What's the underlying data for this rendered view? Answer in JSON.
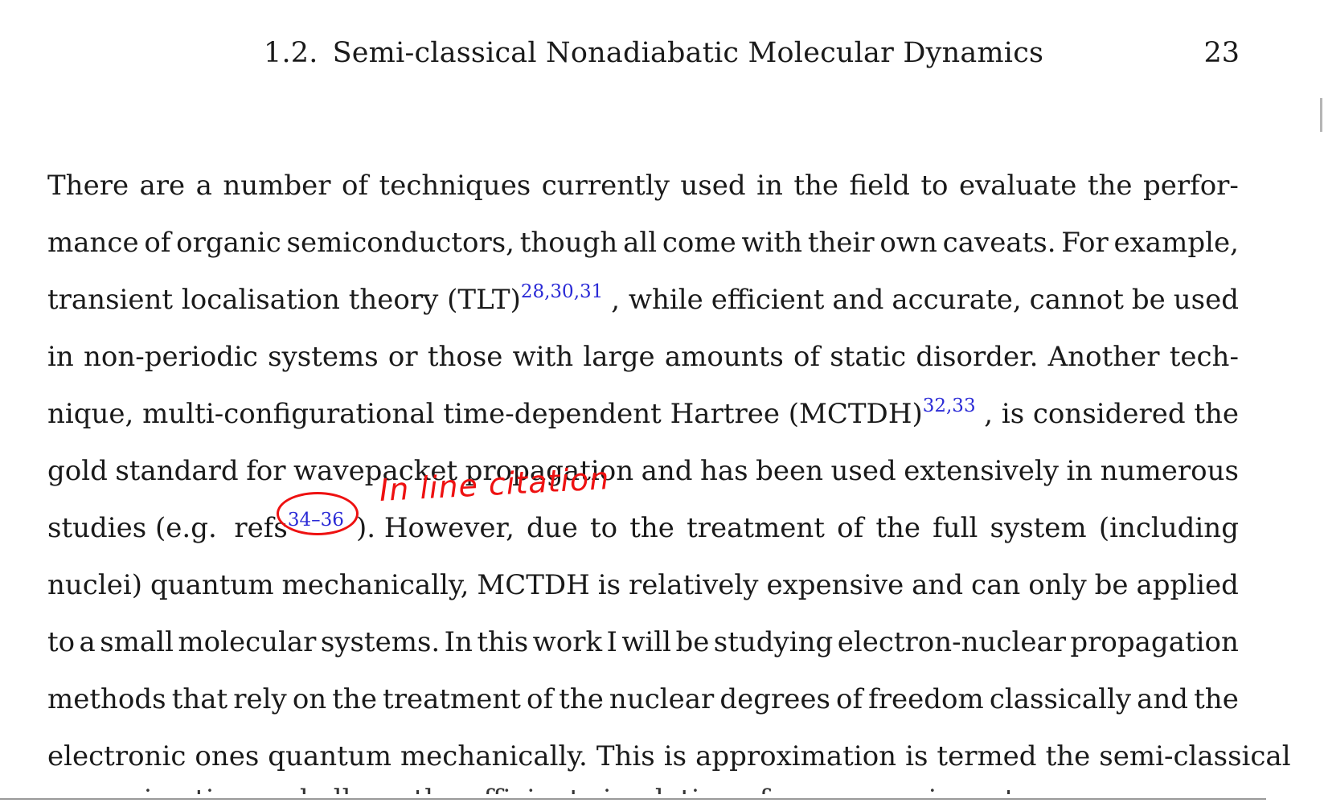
{
  "header": {
    "section_number": "1.2.",
    "section_title": "Semi-classical Nonadiabatic Molecular Dynamics",
    "page_number": "23"
  },
  "paragraph": {
    "l1": [
      "There",
      "are",
      "a",
      "number",
      "of",
      "techniques",
      "currently",
      "used",
      "in",
      "the",
      "field",
      "to",
      "evaluate",
      "the",
      "perfor-"
    ],
    "l2": [
      "mance",
      "of",
      "organic",
      "semiconductors,",
      "though",
      "all",
      "come",
      "with",
      "their",
      "own",
      "caveats.",
      "For",
      "example,"
    ],
    "l3_text": "transient localisation theory (TLT)",
    "l3_cite": "28,30,31",
    "l3_rest": [
      ", while",
      "efficient",
      "and",
      "accurate,",
      "cannot",
      "be",
      "used"
    ],
    "l4": [
      "in",
      "non-periodic",
      "systems",
      "or",
      "those",
      "with",
      "large",
      "amounts",
      "of",
      "static",
      "disorder.",
      "Another",
      "tech-"
    ],
    "l5_text": "nique, multi-configurational time-dependent Hartree (MCTDH)",
    "l5_cite": "32,33",
    "l5_rest": [
      ", is",
      "considered",
      "the"
    ],
    "l6": [
      "gold",
      "standard",
      "for",
      "wavepacket",
      "propagation",
      "and",
      "has",
      "been",
      "used",
      "extensively",
      "in",
      "numerous"
    ],
    "l7_pre": "studies (e.g.  refs",
    "l7_cite": "34–36",
    "l7_rest": [
      "). However,",
      "due",
      "to",
      "the",
      "treatment",
      "of",
      "the",
      "full",
      "system",
      "(including"
    ],
    "l8": [
      "nuclei)",
      "quantum",
      "mechanically,",
      "MCTDH",
      "is",
      "relatively",
      "expensive",
      "and",
      "can",
      "only",
      "be",
      "applied"
    ],
    "l9": [
      "to",
      "a",
      "small",
      "molecular",
      "systems.",
      "In",
      "this",
      "work",
      "I",
      "will",
      "be",
      "studying",
      "electron-nuclear",
      "propagation"
    ],
    "l10": [
      "methods",
      "that",
      "rely",
      "on",
      "the",
      "treatment",
      "of",
      "the",
      "nuclear",
      "degrees",
      "of",
      "freedom",
      "classically",
      "and",
      "the"
    ],
    "l11": [
      "electronic",
      "ones",
      "quantum",
      "mechanically.",
      "This",
      "is",
      "approximation",
      "is",
      "termed",
      "the",
      "semi-classical"
    ],
    "next_line_fragment": "approximation and allows the efficient simulation of macroscopic systems"
  },
  "annotation": {
    "handwritten_note": "In line citation",
    "color": "#ee1111"
  },
  "colors": {
    "citation": "#2a2ad6",
    "text": "#1a1a1a"
  }
}
